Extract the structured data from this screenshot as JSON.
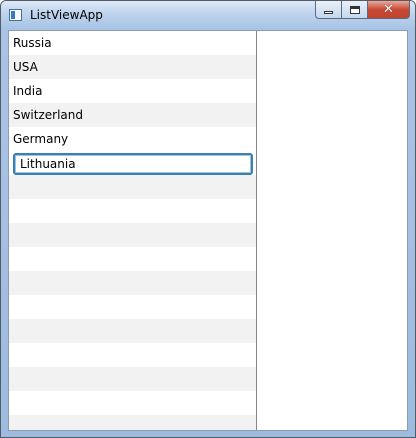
{
  "window": {
    "title": "ListViewApp"
  },
  "caption": {
    "minimize": "minimize",
    "maximize": "maximize",
    "close": "close"
  },
  "list": {
    "items": [
      {
        "label": "Russia"
      },
      {
        "label": "USA"
      },
      {
        "label": "India"
      },
      {
        "label": "Switzerland"
      },
      {
        "label": "Germany"
      }
    ],
    "editing_value": "Lithuania"
  },
  "colors": {
    "alt_row": "#f2f2f2",
    "focus_border": "#3c7fb1",
    "close_button": "#c74a36"
  }
}
